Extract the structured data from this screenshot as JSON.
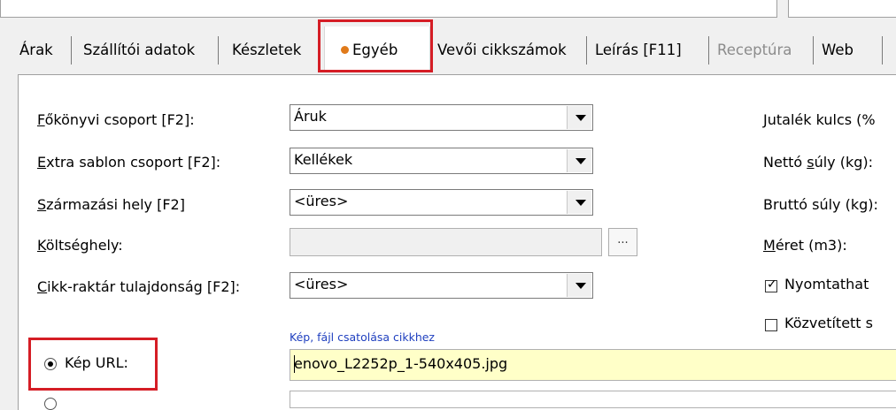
{
  "tabs": [
    {
      "label": "Árak",
      "disabled": false
    },
    {
      "label": "Szállítói adatok",
      "disabled": false
    },
    {
      "label": "Készletek",
      "disabled": false
    },
    {
      "label": "Egyéb",
      "disabled": false,
      "active": true
    },
    {
      "label": "Vevői cikkszámok",
      "disabled": false
    },
    {
      "label": "Leírás [F11]",
      "disabled": false
    },
    {
      "label": "Receptúra",
      "disabled": true
    },
    {
      "label": "Web",
      "disabled": false
    }
  ],
  "form": {
    "fokonyvi": {
      "label_first": "F",
      "label_rest": "őkönyvi csoport [F2]:",
      "value": "Áruk"
    },
    "extra": {
      "label": "Extra sablon csoport [F2]:",
      "label_first": "E",
      "label_rest": "xtra sablon csoport [F2]:",
      "value": "Kellékek"
    },
    "szarmazasi": {
      "label_first": "S",
      "label_rest": "zármazási hely [F2]",
      "value": "<üres>"
    },
    "koltseghely": {
      "label_first": "K",
      "label_rest": "öltséghely:",
      "value": "",
      "button": "..."
    },
    "cikk_raktar": {
      "label_first": "C",
      "label_rest": "ikk-raktár tulajdonság [F2]:",
      "value": "<üres>"
    }
  },
  "right_labels": {
    "jutalek": "Jutalék kulcs (%",
    "netto_pre": "Nettó ",
    "netto_u": "s",
    "netto_post": "úly (kg):",
    "brutto": "Bruttó súly (kg):",
    "meret_u": "M",
    "meret_rest": "éret (m3):",
    "nyomtathato": {
      "label": "Nyomtathat",
      "checked": true
    },
    "kozvetitett": {
      "label": "Közvetített s",
      "checked": false
    }
  },
  "attach": {
    "caption": "Kép, fájl csatolása cikkhez",
    "radio_label": "Kép URL:",
    "url_value": "enovo_L2252p_1-540x405.jpg"
  },
  "colors": {
    "highlight": "#d51d25",
    "caption": "#1f3fbf",
    "url_bg": "#ffffc8",
    "dot": "#e07a1a"
  }
}
